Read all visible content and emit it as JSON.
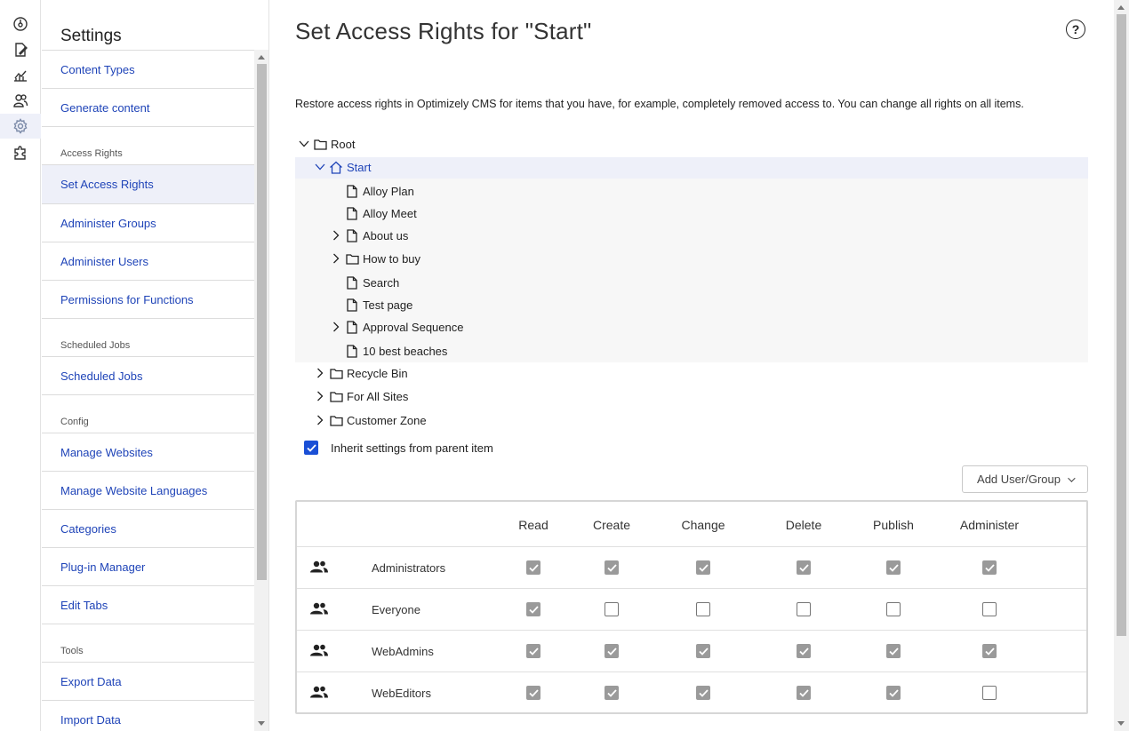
{
  "rail": {
    "items": [
      {
        "name": "dashboard-icon"
      },
      {
        "name": "edit-icon"
      },
      {
        "name": "reports-icon"
      },
      {
        "name": "users-icon"
      },
      {
        "name": "settings-icon",
        "active": true
      },
      {
        "name": "addons-icon"
      }
    ]
  },
  "sidebar": {
    "title": "Settings",
    "entries": [
      {
        "type": "link",
        "label": "Content Types"
      },
      {
        "type": "link",
        "label": "Generate content"
      },
      {
        "type": "group",
        "label": "Access Rights"
      },
      {
        "type": "link",
        "label": "Set Access Rights",
        "active": true
      },
      {
        "type": "link",
        "label": "Administer Groups"
      },
      {
        "type": "link",
        "label": "Administer Users"
      },
      {
        "type": "link",
        "label": "Permissions for Functions"
      },
      {
        "type": "group",
        "label": "Scheduled Jobs"
      },
      {
        "type": "link",
        "label": "Scheduled Jobs"
      },
      {
        "type": "group",
        "label": "Config"
      },
      {
        "type": "link",
        "label": "Manage Websites"
      },
      {
        "type": "link",
        "label": "Manage Website Languages"
      },
      {
        "type": "link",
        "label": "Categories"
      },
      {
        "type": "link",
        "label": "Plug-in Manager"
      },
      {
        "type": "link",
        "label": "Edit Tabs"
      },
      {
        "type": "group",
        "label": "Tools"
      },
      {
        "type": "link",
        "label": "Export Data"
      },
      {
        "type": "link",
        "label": "Import Data"
      }
    ]
  },
  "main": {
    "title": "Set Access Rights for \"Start\"",
    "help_label": "?",
    "intro": "Restore access rights in Optimizely CMS for items that you have, for example, completely removed access to. You can change all rights on all items.",
    "tree": [
      {
        "label": "Root",
        "icon": "folder",
        "toggle": "expanded"
      },
      {
        "label": "Start",
        "icon": "home",
        "toggle": "expanded",
        "selected": true
      },
      {
        "label": "Alloy Plan",
        "icon": "page",
        "toggle": "none"
      },
      {
        "label": "Alloy Meet",
        "icon": "page",
        "toggle": "none"
      },
      {
        "label": "About us",
        "icon": "page",
        "toggle": "collapsed"
      },
      {
        "label": "How to buy",
        "icon": "folder",
        "toggle": "collapsed"
      },
      {
        "label": "Search",
        "icon": "page",
        "toggle": "none"
      },
      {
        "label": "Test page",
        "icon": "page",
        "toggle": "none"
      },
      {
        "label": "Approval Sequence",
        "icon": "page",
        "toggle": "collapsed"
      },
      {
        "label": "10 best beaches",
        "icon": "page",
        "toggle": "none"
      },
      {
        "label": "Recycle Bin",
        "icon": "folder",
        "toggle": "collapsed"
      },
      {
        "label": "For All Sites",
        "icon": "folder",
        "toggle": "collapsed"
      },
      {
        "label": "Customer Zone",
        "icon": "folder",
        "toggle": "collapsed"
      }
    ],
    "inherit_label": "Inherit settings from parent item",
    "inherit_checked": true,
    "add_button": "Add User/Group",
    "table": {
      "columns": [
        "Read",
        "Create",
        "Change",
        "Delete",
        "Publish",
        "Administer"
      ],
      "rows": [
        {
          "name": "Administrators",
          "rights": [
            true,
            true,
            true,
            true,
            true,
            true
          ]
        },
        {
          "name": "Everyone",
          "rights": [
            true,
            false,
            false,
            false,
            false,
            false
          ]
        },
        {
          "name": "WebAdmins",
          "rights": [
            true,
            true,
            true,
            true,
            true,
            true
          ]
        },
        {
          "name": "WebEditors",
          "rights": [
            true,
            true,
            true,
            true,
            true,
            false
          ]
        }
      ]
    }
  }
}
